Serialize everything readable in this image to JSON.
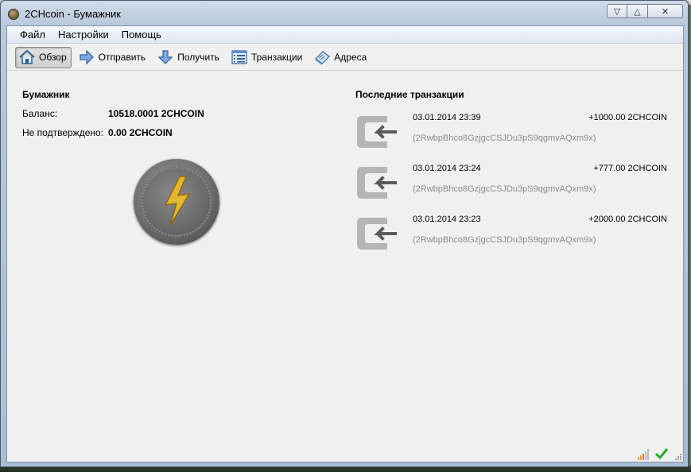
{
  "window": {
    "title": "2CHcoin - Бумажник",
    "buttons": [
      "▽",
      "△",
      "✕"
    ]
  },
  "menu": [
    "Файл",
    "Настройки",
    "Помощь"
  ],
  "toolbar": [
    {
      "label": "Обзор",
      "icon": "home-icon",
      "active": true
    },
    {
      "label": "Отправить",
      "icon": "send-arrow-icon",
      "active": false
    },
    {
      "label": "Получить",
      "icon": "receive-arrow-icon",
      "active": false
    },
    {
      "label": "Транзакции",
      "icon": "transactions-list-icon",
      "active": false
    },
    {
      "label": "Адреса",
      "icon": "address-book-icon",
      "active": false
    }
  ],
  "wallet": {
    "title": "Бумажник",
    "balance_label": "Баланс:",
    "balance_value": "10518.0001 2CHCOIN",
    "unconfirmed_label": "Не подтверждено:",
    "unconfirmed_value": "0.00 2CHCOIN"
  },
  "recent": {
    "title": "Последние транзакции",
    "items": [
      {
        "date": "03.01.2014 23:39",
        "amount": "+1000.00 2CHCOIN",
        "address": "(2RwbpBhco8GzjgcCSJDu3pS9qgmvAQxm9x)"
      },
      {
        "date": "03.01.2014 23:24",
        "amount": "+777.00 2CHCOIN",
        "address": "(2RwbpBhco8GzjgcCSJDu3pS9qgmvAQxm9x)"
      },
      {
        "date": "03.01.2014 23:23",
        "amount": "+2000.00 2CHCOIN",
        "address": "(2RwbpBhco8GzjgcCSJDu3pS9qgmvAQxm9x)"
      }
    ]
  },
  "status": {
    "icons": [
      "signal-bars-icon",
      "synced-checkmark-icon"
    ]
  }
}
